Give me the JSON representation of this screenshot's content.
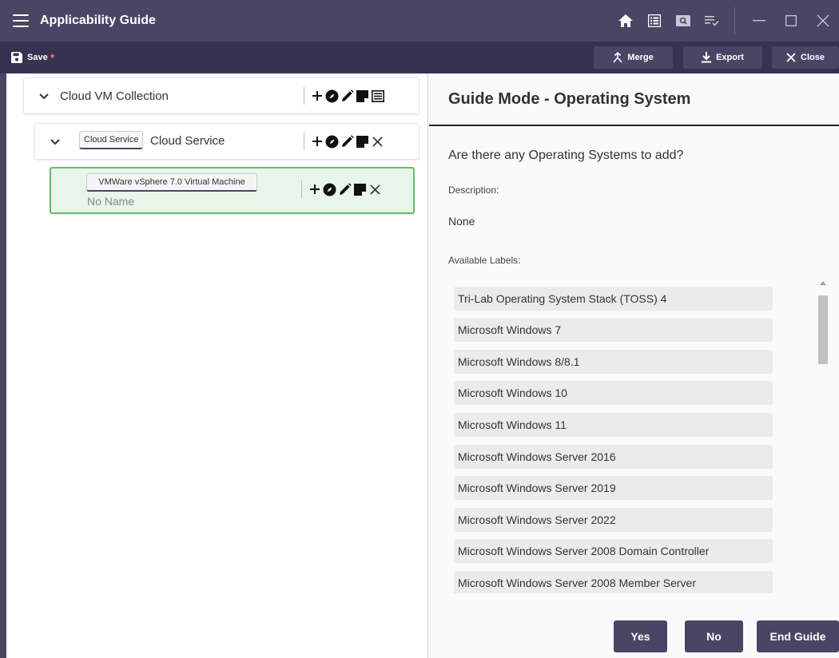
{
  "window": {
    "title": "Applicability Guide"
  },
  "toolbar": {
    "save_label": "Save",
    "unsaved_marker": "*",
    "merge_label": "Merge",
    "export_label": "Export",
    "close_label": "Close"
  },
  "tree": {
    "root": {
      "label": "Cloud VM Collection"
    },
    "child": {
      "type": "Cloud Service",
      "label": "Cloud Service"
    },
    "leaf": {
      "type": "VMWare vSphere 7.0 Virtual Machine",
      "name": "No Name"
    }
  },
  "guide": {
    "header": "Guide Mode - Operating System",
    "question": "Are there any Operating Systems to add?",
    "description_label": "Description:",
    "description_value": "None",
    "available_labels_title": "Available Labels:",
    "labels": [
      "Tri-Lab Operating System Stack (TOSS) 4",
      "Microsoft Windows 7",
      "Microsoft Windows 8/8.1",
      "Microsoft Windows 10",
      "Microsoft Windows 11",
      "Microsoft Windows Server 2016",
      "Microsoft Windows Server 2019",
      "Microsoft Windows Server 2022",
      "Microsoft Windows Server 2008 Domain Controller",
      "Microsoft Windows Server 2008 Member Server"
    ],
    "yes_label": "Yes",
    "no_label": "No",
    "end_label": "End Guide"
  },
  "colors": {
    "titlebar": "#4a4565",
    "toolbar": "#37324f",
    "selected_node_bg": "#e8f5e9",
    "selected_node_border": "#66bb6a"
  }
}
